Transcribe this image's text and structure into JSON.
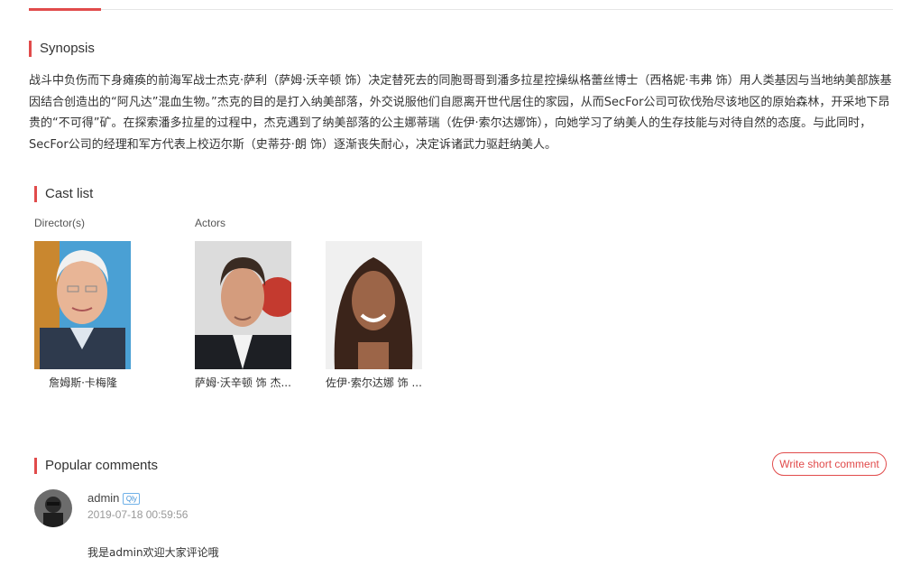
{
  "synopsis": {
    "title": "Synopsis",
    "text": "战斗中负伤而下身瘫痪的前海军战士杰克·萨利（萨姆·沃辛顿 饰）决定替死去的同胞哥哥到潘多拉星控操纵格蕾丝博士（西格妮·韦弗 饰）用人类基因与当地纳美部族基因结合创造出的“阿凡达”混血生物。”杰克的目的是打入纳美部落，外交说服他们自愿离开世代居住的家园，从而SecFor公司可砍伐殆尽该地区的原始森林，开采地下昂贵的“不可得”矿。在探索潘多拉星的过程中，杰克遇到了纳美部落的公主娜蒂瑞（佐伊·索尔达娜饰），向她学习了纳美人的生存技能与对待自然的态度。与此同时，SecFor公司的经理和军方代表上校迈尔斯（史蒂芬·朗 饰）逐渐丧失耐心，决定诉诸武力驱赶纳美人。"
  },
  "cast": {
    "title": "Cast list",
    "director_label": "Director(s)",
    "actors_label": "Actors",
    "people": [
      {
        "name": "詹姆斯·卡梅隆"
      },
      {
        "name": "萨姆·沃辛顿 饰 杰..."
      },
      {
        "name": "佐伊·索尔达娜 饰 ..."
      }
    ]
  },
  "comments": {
    "title": "Popular comments",
    "write_button": "Write short comment",
    "items": [
      {
        "user": "admin",
        "badge": "Qly",
        "time": "2019-07-18 00:59:56",
        "text": "我是admin欢迎大家评论哦"
      }
    ]
  },
  "colors": {
    "accent": "#e14b4b"
  }
}
